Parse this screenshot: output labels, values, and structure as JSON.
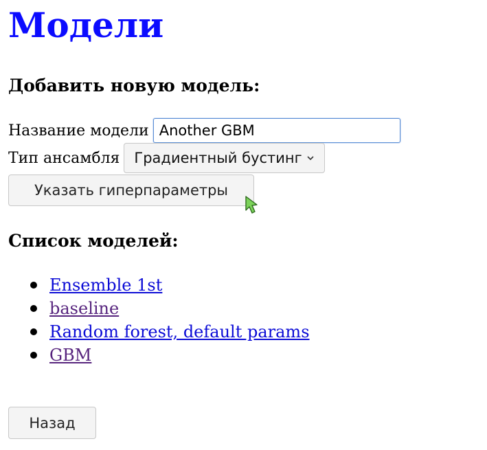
{
  "page_title": "Модели",
  "add_section": {
    "title": "Добавить новую модель:",
    "name_label": "Название модели",
    "name_value": "Another GBM",
    "type_label": "Тип ансамбля",
    "type_selected": "Градиентный бустинг",
    "hyperparams_button": "Указать гиперпараметры"
  },
  "list_section": {
    "title": "Список моделей:",
    "models": [
      {
        "label": "Ensemble 1st",
        "visited": false
      },
      {
        "label": "baseline",
        "visited": true
      },
      {
        "label": "Random forest, default params",
        "visited": false
      },
      {
        "label": "GBM",
        "visited": true
      }
    ]
  },
  "back_button": "Назад",
  "colors": {
    "title": "#0b0bff",
    "link": "#0b0bd6",
    "link_visited": "#56237d",
    "input_focus_border": "#5b8fd6",
    "cursor_fill": "#7cd35a"
  }
}
